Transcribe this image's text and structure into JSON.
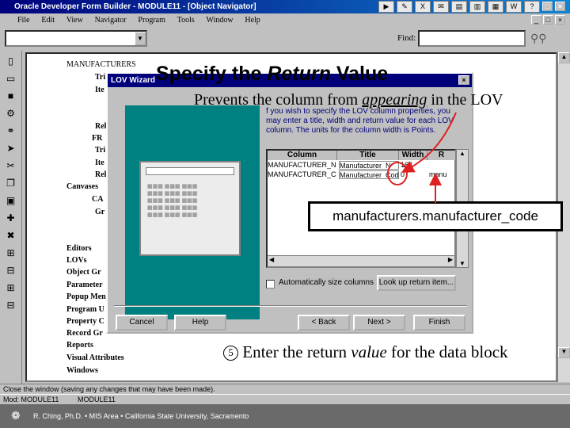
{
  "window": {
    "title": "Oracle Developer Form Builder - MODULE11 - [Object Navigator]",
    "menu": [
      "File",
      "Edit",
      "View",
      "Navigator",
      "Program",
      "Tools",
      "Window",
      "Help"
    ]
  },
  "toolbar": {
    "find_label": "Find:"
  },
  "navigator": {
    "items": [
      {
        "label": "MANUFACTURERS"
      },
      {
        "label": "Tri"
      },
      {
        "label": "Ite"
      },
      {
        "label": "Rel"
      },
      {
        "label": "FR"
      },
      {
        "label": "Tri"
      },
      {
        "label": "Ite"
      },
      {
        "label": "Rel"
      },
      {
        "label": "Canvases"
      },
      {
        "label": "CA"
      },
      {
        "label": "Gr"
      },
      {
        "label": "Editors"
      },
      {
        "label": "LOVs"
      },
      {
        "label": "Object Gr"
      },
      {
        "label": "Parameter"
      },
      {
        "label": "Popup Men"
      },
      {
        "label": "Program U"
      },
      {
        "label": "Property C"
      },
      {
        "label": "Record Gr"
      },
      {
        "label": "Reports"
      },
      {
        "label": "Visual Attributes"
      },
      {
        "label": "Windows"
      }
    ]
  },
  "wizard": {
    "title": "LOV Wizard",
    "instructions": "f you wish to specify the LOV column properties, you may enter a title, width and return value for each LOV column. The units for the column width is Points.",
    "columns": [
      "Column",
      "Title",
      "Width",
      "R"
    ],
    "rows": [
      {
        "column": "MANUFACTURER_N",
        "title": "Manufacturer_N",
        "width": "163",
        "return": ""
      },
      {
        "column": "MANUFACTURER_C",
        "title": "Manufacturer_Cod",
        "width": "0",
        "return": "manu"
      }
    ],
    "auto_size_label": "Automatically size columns",
    "lookup_button": "Look up return item...",
    "buttons": {
      "cancel": "Cancel",
      "help": "Help",
      "back": "< Back",
      "next": "Next >",
      "finish": "Finish"
    }
  },
  "status": {
    "line1": "Close the window (saving any changes that may have been made).",
    "mod": "Mod: MODULE11",
    "module": "MODULE11"
  },
  "footer": {
    "credit": "R. Ching, Ph.D. • MIS Area • California State University, Sacramento"
  },
  "overlay": {
    "heading_pre": "Specify the ",
    "heading_em": "Return",
    "heading_post": " Value",
    "sub_pre": "Prevents the column from ",
    "sub_em": "appearing",
    "sub_post": " in the LOV",
    "callout": "manufacturers.manufacturer_code",
    "step_number": "5",
    "step_pre": " Enter the return ",
    "step_em": "value",
    "step_post": " for the data block"
  },
  "colors": {
    "titlebar": "#00007b",
    "panel": "#c0c0c0",
    "annotation": "#e02020"
  }
}
